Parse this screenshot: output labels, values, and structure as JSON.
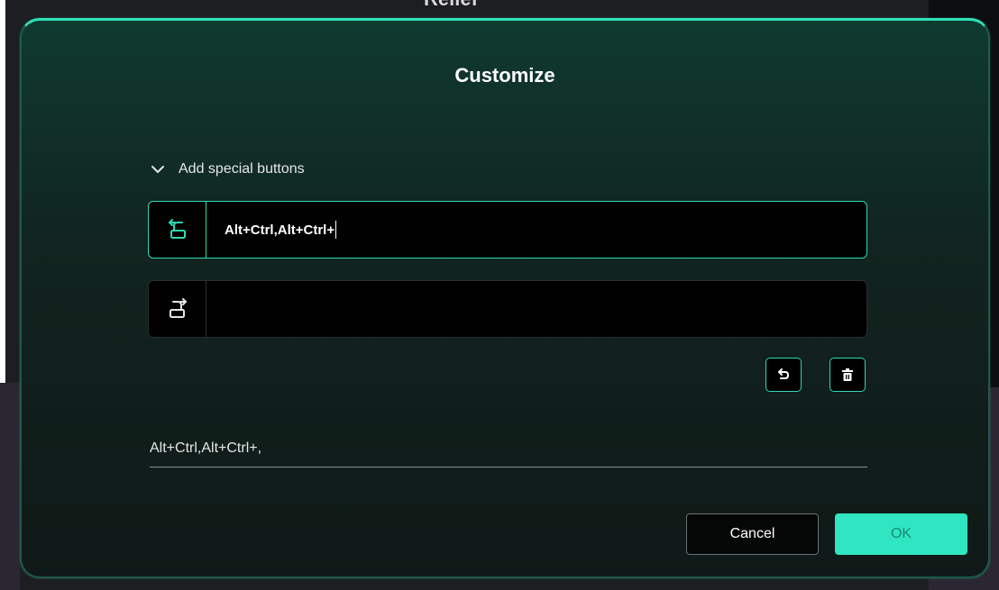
{
  "background": {
    "app_title": "Relief"
  },
  "dialog": {
    "title": "Customize",
    "section": {
      "label": "Add special buttons",
      "expanded": true,
      "icon": "chevron-down-icon"
    },
    "rows": [
      {
        "icon": "rotate-ccw-icon",
        "value": "Alt+Ctrl,Alt+Ctrl+",
        "active": true
      },
      {
        "icon": "rotate-cw-icon",
        "value": "",
        "active": false
      }
    ],
    "actions": {
      "undo_icon": "undo-icon",
      "delete_icon": "trash-icon"
    },
    "summary": "Alt+Ctrl,Alt+Ctrl+,",
    "buttons": {
      "cancel": "Cancel",
      "ok": "OK"
    }
  },
  "colors": {
    "accent": "#2fe0b6",
    "ok_background": "#2fe5c2",
    "ok_text": "#178b74",
    "field_background": "#000000"
  }
}
